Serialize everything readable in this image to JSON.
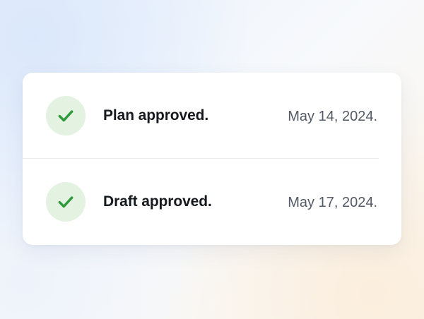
{
  "approvals": [
    {
      "label": "Plan approved.",
      "date": "May 14, 2024.",
      "icon": "check-icon"
    },
    {
      "label": "Draft approved.",
      "date": "May 17, 2024.",
      "icon": "check-icon"
    }
  ],
  "colors": {
    "check": "#2e9a3c",
    "check_bg": "#e3f2e1",
    "title_text": "#16191d",
    "date_text": "#545b66"
  }
}
